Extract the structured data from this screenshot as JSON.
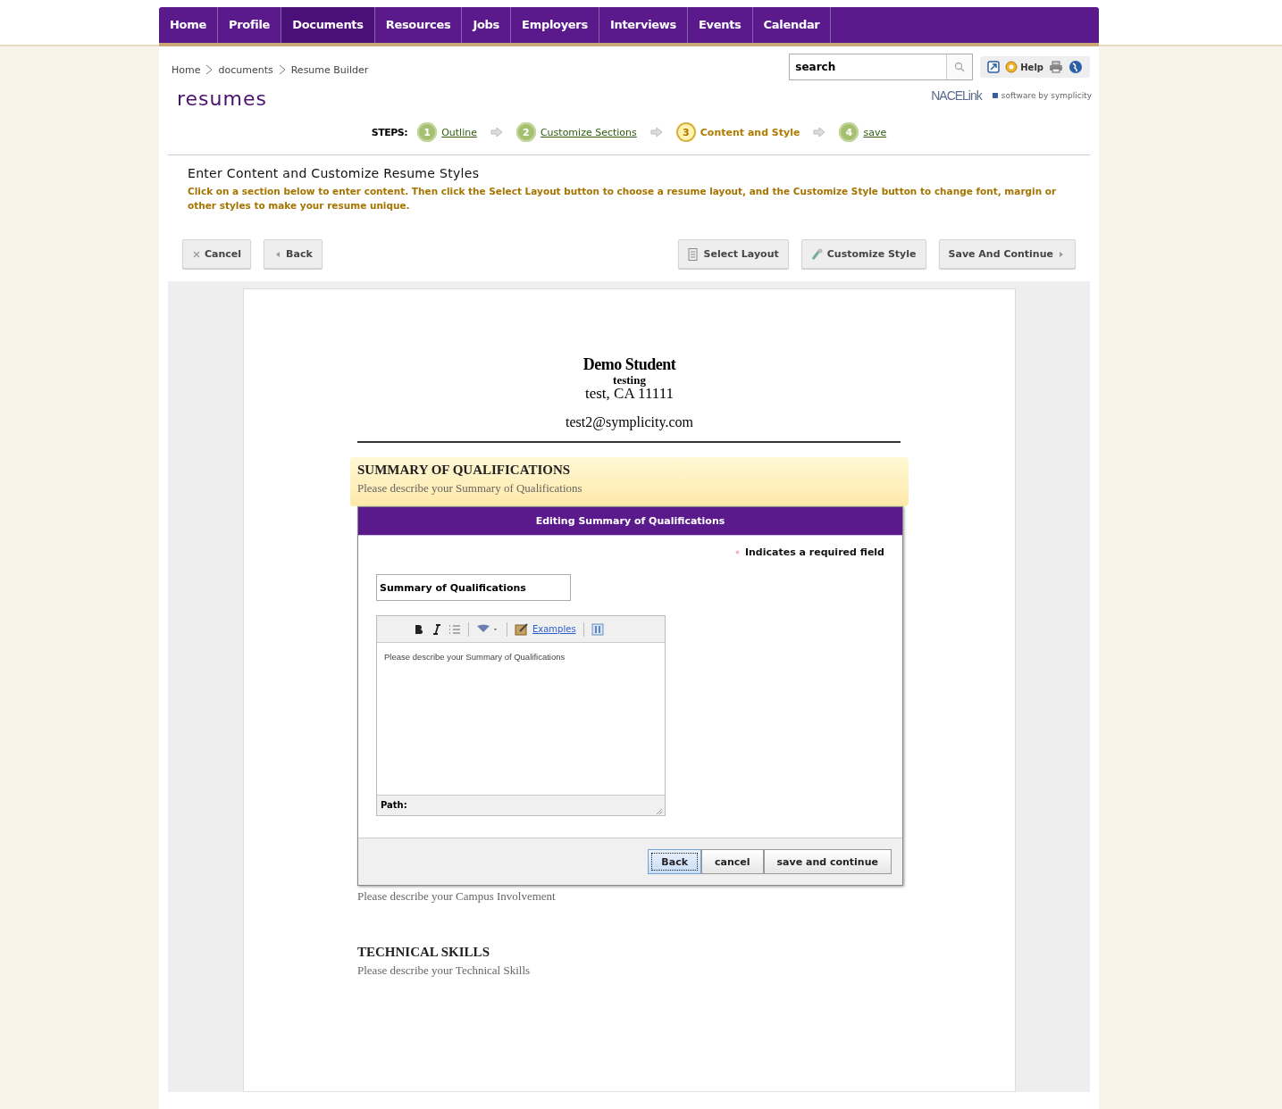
{
  "nav": {
    "tabs": [
      {
        "label": "Home",
        "selected": false
      },
      {
        "label": "Profile",
        "selected": false
      },
      {
        "label": "Documents",
        "selected": true
      },
      {
        "label": "Resources",
        "selected": false
      },
      {
        "label": "Jobs",
        "selected": false
      },
      {
        "label": "Employers",
        "selected": false
      },
      {
        "label": "Interviews",
        "selected": false
      },
      {
        "label": "Events",
        "selected": false
      },
      {
        "label": "Calendar",
        "selected": false
      }
    ]
  },
  "breadcrumb": [
    "Home",
    "documents",
    "Resume Builder"
  ],
  "search": {
    "value": "search"
  },
  "utility": {
    "help": "Help"
  },
  "page_title": "resumes",
  "branding": {
    "partner": "NACELink",
    "credit": "software by symplicity"
  },
  "steps": {
    "label": "STEPS:",
    "items": [
      {
        "number": "1",
        "label": "Outline",
        "selected": false
      },
      {
        "number": "2",
        "label": "Customize Sections",
        "selected": false
      },
      {
        "number": "3",
        "label": "Content and Style",
        "selected": true
      },
      {
        "number": "4",
        "label": "save",
        "selected": false
      }
    ]
  },
  "intro": {
    "heading": "Enter Content and Customize Resume Styles",
    "text": "Click on a section below to enter content. Then click the Select Layout button to choose a resume layout, and the Customize Style button to change font, margin or other styles to make your resume unique."
  },
  "actions": {
    "left": [
      {
        "label": "Cancel"
      },
      {
        "label": "Back"
      }
    ],
    "right": [
      {
        "label": "Select Layout"
      },
      {
        "label": "Customize Style"
      },
      {
        "label": "Save And Continue"
      }
    ]
  },
  "resume": {
    "name": "Demo Student",
    "address_1": "testing",
    "address_2": "test, CA 11111",
    "email": "test2@symplicity.com",
    "sections": [
      {
        "heading": "SUMMARY OF QUALIFICATIONS",
        "description": "Please describe your Summary of Qualifications",
        "highlighted": true
      },
      {
        "description": "Please describe your Campus Involvement",
        "highlighted": false
      },
      {
        "heading": "TECHNICAL SKILLS",
        "description": "Please describe your Technical Skills",
        "highlighted": false
      }
    ]
  },
  "dialog": {
    "title": "Editing Summary of Qualifications",
    "required_note": "Indicates a required field",
    "section_title": "Summary of Qualifications",
    "toolbar": {
      "examples": "Examples"
    },
    "editor_text": "Please describe your Summary of Qualifications",
    "path_label": "Path:",
    "buttons": [
      {
        "label": "Back",
        "selected": true
      },
      {
        "label": "cancel",
        "selected": false
      },
      {
        "label": "save and continue",
        "selected": false
      }
    ]
  }
}
